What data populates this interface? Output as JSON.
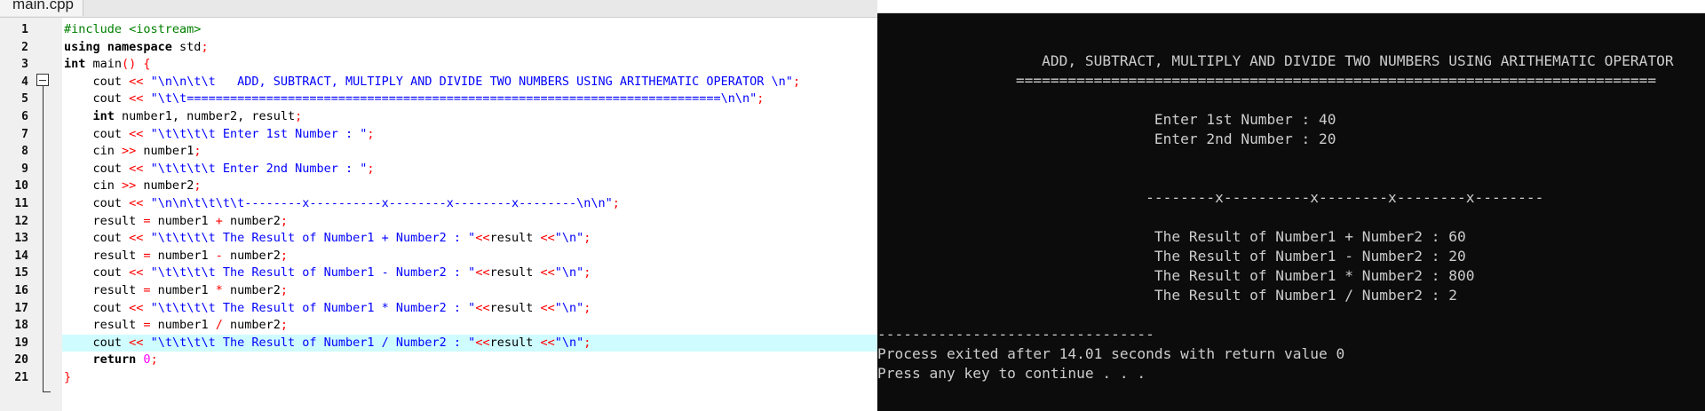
{
  "editor": {
    "tab_label": "main.cpp",
    "highlighted_line": 19,
    "lines": [
      {
        "n": "1",
        "tokens": [
          {
            "t": "#include <iostream>",
            "c": "pp"
          }
        ]
      },
      {
        "n": "2",
        "tokens": [
          {
            "t": "using namespace",
            "c": "kw"
          },
          {
            "t": " std",
            "c": "pl"
          },
          {
            "t": ";",
            "c": "op"
          }
        ]
      },
      {
        "n": "3",
        "tokens": [
          {
            "t": "int",
            "c": "kw"
          },
          {
            "t": " main",
            "c": "pl"
          },
          {
            "t": "() {",
            "c": "op"
          }
        ]
      },
      {
        "n": "4",
        "tokens": [
          {
            "t": "    cout ",
            "c": "pl"
          },
          {
            "t": "<<",
            "c": "op"
          },
          {
            "t": " ",
            "c": "pl"
          },
          {
            "t": "\"\\n\\n\\t\\t   ADD, SUBTRACT, MULTIPLY AND DIVIDE TWO NUMBERS USING ARITHEMATIC OPERATOR \\n\"",
            "c": "str"
          },
          {
            "t": ";",
            "c": "op"
          }
        ]
      },
      {
        "n": "5",
        "tokens": [
          {
            "t": "    cout ",
            "c": "pl"
          },
          {
            "t": "<<",
            "c": "op"
          },
          {
            "t": " ",
            "c": "pl"
          },
          {
            "t": "\"\\t\\t==========================================================================\\n\\n\"",
            "c": "str"
          },
          {
            "t": ";",
            "c": "op"
          }
        ]
      },
      {
        "n": "6",
        "tokens": [
          {
            "t": "    int",
            "c": "kw"
          },
          {
            "t": " number1, number2, result",
            "c": "pl"
          },
          {
            "t": ";",
            "c": "op"
          }
        ]
      },
      {
        "n": "7",
        "tokens": [
          {
            "t": "    cout ",
            "c": "pl"
          },
          {
            "t": "<<",
            "c": "op"
          },
          {
            "t": " ",
            "c": "pl"
          },
          {
            "t": "\"\\t\\t\\t\\t Enter 1st Number : \"",
            "c": "str"
          },
          {
            "t": ";",
            "c": "op"
          }
        ]
      },
      {
        "n": "8",
        "tokens": [
          {
            "t": "    cin ",
            "c": "pl"
          },
          {
            "t": ">>",
            "c": "op"
          },
          {
            "t": " number1",
            "c": "pl"
          },
          {
            "t": ";",
            "c": "op"
          }
        ]
      },
      {
        "n": "9",
        "tokens": [
          {
            "t": "    cout ",
            "c": "pl"
          },
          {
            "t": "<<",
            "c": "op"
          },
          {
            "t": " ",
            "c": "pl"
          },
          {
            "t": "\"\\t\\t\\t\\t Enter 2nd Number : \"",
            "c": "str"
          },
          {
            "t": ";",
            "c": "op"
          }
        ]
      },
      {
        "n": "10",
        "tokens": [
          {
            "t": "    cin ",
            "c": "pl"
          },
          {
            "t": ">>",
            "c": "op"
          },
          {
            "t": " number2",
            "c": "pl"
          },
          {
            "t": ";",
            "c": "op"
          }
        ]
      },
      {
        "n": "11",
        "tokens": [
          {
            "t": "    cout ",
            "c": "pl"
          },
          {
            "t": "<<",
            "c": "op"
          },
          {
            "t": " ",
            "c": "pl"
          },
          {
            "t": "\"\\n\\n\\t\\t\\t\\t--------x----------x--------x--------x--------\\n\\n\"",
            "c": "str"
          },
          {
            "t": ";",
            "c": "op"
          }
        ]
      },
      {
        "n": "12",
        "tokens": [
          {
            "t": "    result ",
            "c": "pl"
          },
          {
            "t": "=",
            "c": "op"
          },
          {
            "t": " number1 ",
            "c": "pl"
          },
          {
            "t": "+",
            "c": "op"
          },
          {
            "t": " number2",
            "c": "pl"
          },
          {
            "t": ";",
            "c": "op"
          }
        ]
      },
      {
        "n": "13",
        "tokens": [
          {
            "t": "    cout ",
            "c": "pl"
          },
          {
            "t": "<<",
            "c": "op"
          },
          {
            "t": " ",
            "c": "pl"
          },
          {
            "t": "\"\\t\\t\\t\\t The Result of Number1 + Number2 : \"",
            "c": "str"
          },
          {
            "t": "<<",
            "c": "op"
          },
          {
            "t": "result ",
            "c": "pl"
          },
          {
            "t": "<<",
            "c": "op"
          },
          {
            "t": "\"\\n\"",
            "c": "str"
          },
          {
            "t": ";",
            "c": "op"
          }
        ]
      },
      {
        "n": "14",
        "tokens": [
          {
            "t": "    result ",
            "c": "pl"
          },
          {
            "t": "=",
            "c": "op"
          },
          {
            "t": " number1 ",
            "c": "pl"
          },
          {
            "t": "-",
            "c": "op"
          },
          {
            "t": " number2",
            "c": "pl"
          },
          {
            "t": ";",
            "c": "op"
          }
        ]
      },
      {
        "n": "15",
        "tokens": [
          {
            "t": "    cout ",
            "c": "pl"
          },
          {
            "t": "<<",
            "c": "op"
          },
          {
            "t": " ",
            "c": "pl"
          },
          {
            "t": "\"\\t\\t\\t\\t The Result of Number1 - Number2 : \"",
            "c": "str"
          },
          {
            "t": "<<",
            "c": "op"
          },
          {
            "t": "result ",
            "c": "pl"
          },
          {
            "t": "<<",
            "c": "op"
          },
          {
            "t": "\"\\n\"",
            "c": "str"
          },
          {
            "t": ";",
            "c": "op"
          }
        ]
      },
      {
        "n": "16",
        "tokens": [
          {
            "t": "    result ",
            "c": "pl"
          },
          {
            "t": "=",
            "c": "op"
          },
          {
            "t": " number1 ",
            "c": "pl"
          },
          {
            "t": "*",
            "c": "op"
          },
          {
            "t": " number2",
            "c": "pl"
          },
          {
            "t": ";",
            "c": "op"
          }
        ]
      },
      {
        "n": "17",
        "tokens": [
          {
            "t": "    cout ",
            "c": "pl"
          },
          {
            "t": "<<",
            "c": "op"
          },
          {
            "t": " ",
            "c": "pl"
          },
          {
            "t": "\"\\t\\t\\t\\t The Result of Number1 * Number2 : \"",
            "c": "str"
          },
          {
            "t": "<<",
            "c": "op"
          },
          {
            "t": "result ",
            "c": "pl"
          },
          {
            "t": "<<",
            "c": "op"
          },
          {
            "t": "\"\\n\"",
            "c": "str"
          },
          {
            "t": ";",
            "c": "op"
          }
        ]
      },
      {
        "n": "18",
        "tokens": [
          {
            "t": "    result ",
            "c": "pl"
          },
          {
            "t": "=",
            "c": "op"
          },
          {
            "t": " number1 ",
            "c": "pl"
          },
          {
            "t": "/",
            "c": "op"
          },
          {
            "t": " number2",
            "c": "pl"
          },
          {
            "t": ";",
            "c": "op"
          }
        ]
      },
      {
        "n": "19",
        "tokens": [
          {
            "t": "    cout ",
            "c": "pl"
          },
          {
            "t": "<<",
            "c": "op"
          },
          {
            "t": " ",
            "c": "pl"
          },
          {
            "t": "\"\\t\\t\\t\\t The Result of Number1 / Number2 : \"",
            "c": "str"
          },
          {
            "t": "<<",
            "c": "op"
          },
          {
            "t": "result ",
            "c": "pl"
          },
          {
            "t": "<<",
            "c": "op"
          },
          {
            "t": "\"\\n\"",
            "c": "str"
          },
          {
            "t": ";",
            "c": "op"
          }
        ]
      },
      {
        "n": "20",
        "tokens": [
          {
            "t": "    return",
            "c": "kw"
          },
          {
            "t": " ",
            "c": "pl"
          },
          {
            "t": "0",
            "c": "num"
          },
          {
            "t": ";",
            "c": "op"
          }
        ]
      },
      {
        "n": "21",
        "tokens": [
          {
            "t": "}",
            "c": "op"
          }
        ]
      }
    ]
  },
  "console": {
    "lines": [
      "",
      "",
      "                   ADD, SUBTRACT, MULTIPLY AND DIVIDE TWO NUMBERS USING ARITHEMATIC OPERATOR",
      "                ==========================================================================",
      "",
      "                                Enter 1st Number : 40",
      "                                Enter 2nd Number : 20",
      "",
      "",
      "                               --------x----------x--------x--------x--------",
      "",
      "                                The Result of Number1 + Number2 : 60",
      "                                The Result of Number1 - Number2 : 20",
      "                                The Result of Number1 * Number2 : 800",
      "                                The Result of Number1 / Number2 : 2",
      "",
      "--------------------------------",
      "Process exited after 14.01 seconds with return value 0",
      "Press any key to continue . . ."
    ]
  },
  "colors": {
    "editor_bg": "#ffffff",
    "line_highlight": "#cffcff",
    "string": "#0000ff",
    "operator": "#ff0000",
    "preprocessor": "#008000",
    "number": "#ff00ff",
    "console_bg": "#0c0c0c",
    "console_text": "#cccccc"
  }
}
